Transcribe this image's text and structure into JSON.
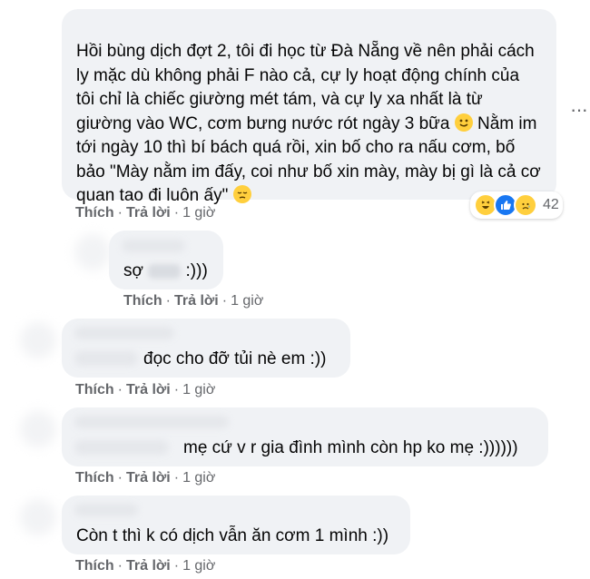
{
  "comments": [
    {
      "text_part1": "Hồi bùng dịch đợt 2, tôi đi học từ Đà Nẵng về nên phải cách ly mặc dù không phải F nào cả, cự ly hoạt động chính của tôi chỉ là chiếc giường mét tám, và cự ly xa nhất là từ giường vào WC, cơm bưng nước rót ngày 3 bữa",
      "text_part2": " Nằm im tới ngày 10 thì bí bách quá rồi, xin bố cho ra nấu cơm, bố bảo \"Mày nằm im đấy, coi như bố xin mày, mày bị gì là cả cơ quan tao đi luôn ấy\"",
      "reaction_count": "42",
      "like": "Thích",
      "reply": "Trả lời",
      "time": "1 giờ"
    },
    {
      "text_before": "sợ",
      "text_after": ":)))",
      "like": "Thích",
      "reply": "Trả lời",
      "time": "1 giờ"
    },
    {
      "text": "đọc cho đỡ tủi nè em :))",
      "like": "Thích",
      "reply": "Trả lời",
      "time": "1 giờ"
    },
    {
      "text": "mẹ cứ v r gia đình mình còn hp ko mẹ :))))))",
      "like": "Thích",
      "reply": "Trả lời",
      "time": "1 giờ"
    },
    {
      "text": "Còn t thì k có dịch vẫn ăn cơm 1 mình :))",
      "like": "Thích",
      "reply": "Trả lời",
      "time": "1 giờ"
    }
  ],
  "separator": "·",
  "more_options": "···",
  "icons": {
    "reactions": [
      "haha-icon",
      "like-icon",
      "sad-icon"
    ],
    "emoji_smile": "slightly-smiling-face-icon",
    "emoji_pensive": "pensive-face-icon"
  },
  "colors": {
    "bubble": "#f0f2f5",
    "meta_text": "#65676b",
    "like_blue": "#1877f2",
    "emoji_yellow": "#ffcf3d"
  }
}
